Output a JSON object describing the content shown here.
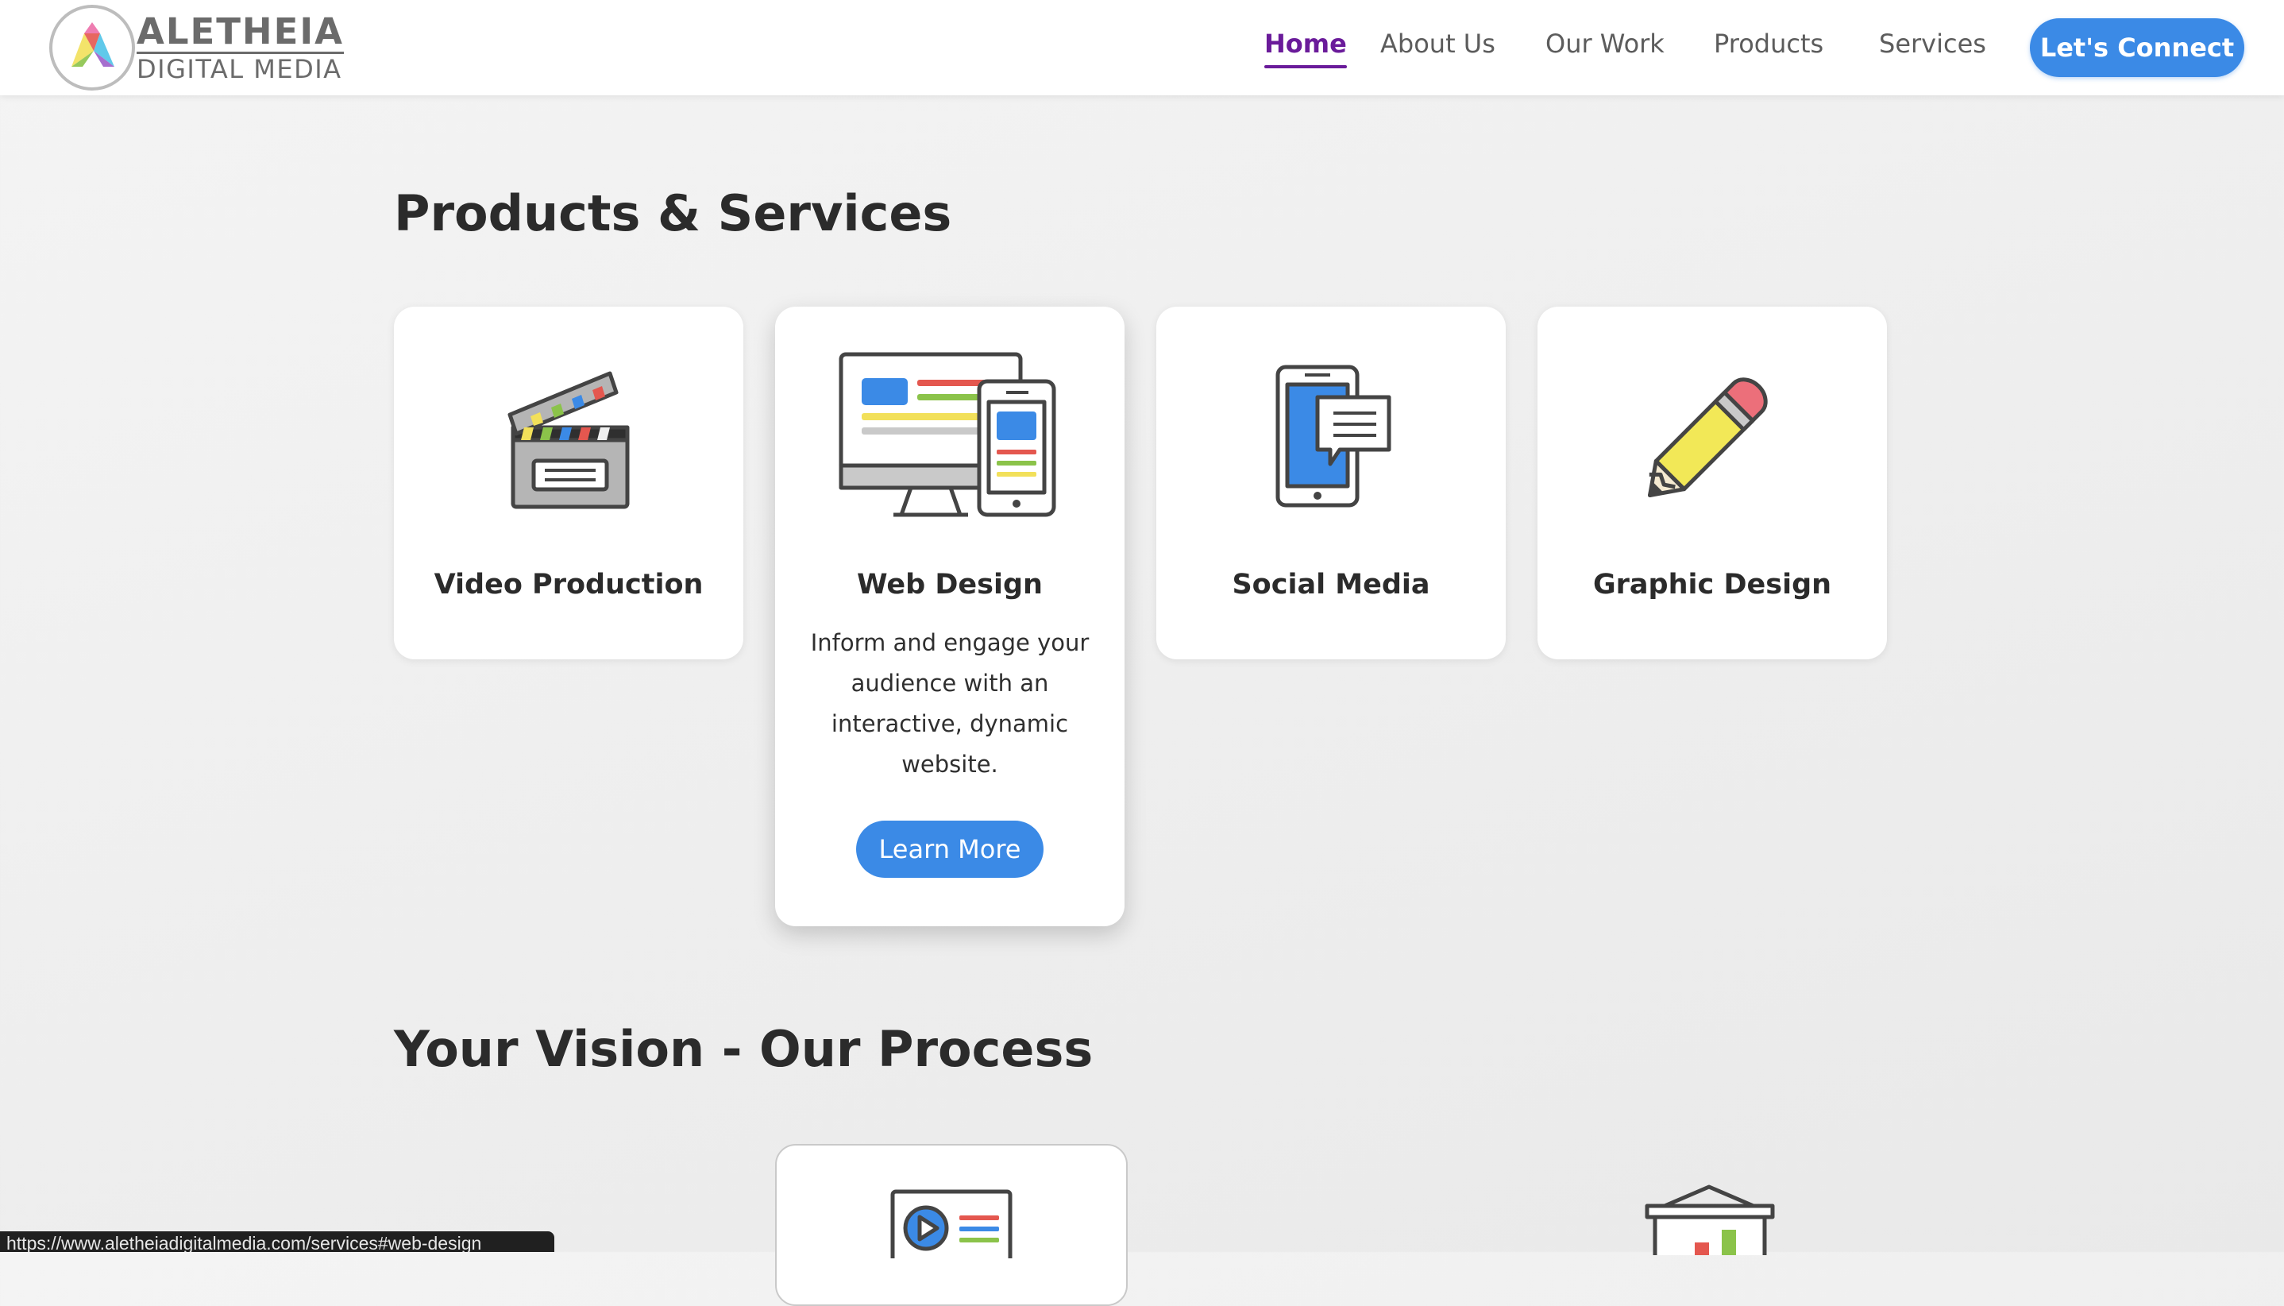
{
  "brand": {
    "title": "ALETHEIA",
    "subtitle": "DIGITAL MEDIA"
  },
  "nav": {
    "items": [
      {
        "label": "Home",
        "active": true
      },
      {
        "label": "About Us",
        "active": false
      },
      {
        "label": "Our Work",
        "active": false
      },
      {
        "label": "Products",
        "active": false
      },
      {
        "label": "Services",
        "active": false
      }
    ],
    "cta_label": "Let's Connect"
  },
  "products": {
    "heading": "Products & Services",
    "cards": [
      {
        "title": "Video Production",
        "icon": "clapperboard-icon"
      },
      {
        "title": "Web Design",
        "icon": "devices-icon",
        "description": "Inform and engage your audience with an interactive, dynamic website.",
        "button_label": "Learn More"
      },
      {
        "title": "Social Media",
        "icon": "phone-chat-icon"
      },
      {
        "title": "Graphic Design",
        "icon": "pencil-icon"
      }
    ]
  },
  "process": {
    "heading": "Your Vision - Our Process",
    "cards": [
      {
        "icon": "video-presentation-icon"
      },
      {
        "icon": "presentation-board-icon"
      }
    ]
  },
  "status_bar": {
    "url": "https://www.aletheiadigitalmedia.com/services#web-design"
  },
  "colors": {
    "accent": "#3b8ae6",
    "active_nav": "#6a1b9a",
    "text": "#2b2b2b"
  }
}
